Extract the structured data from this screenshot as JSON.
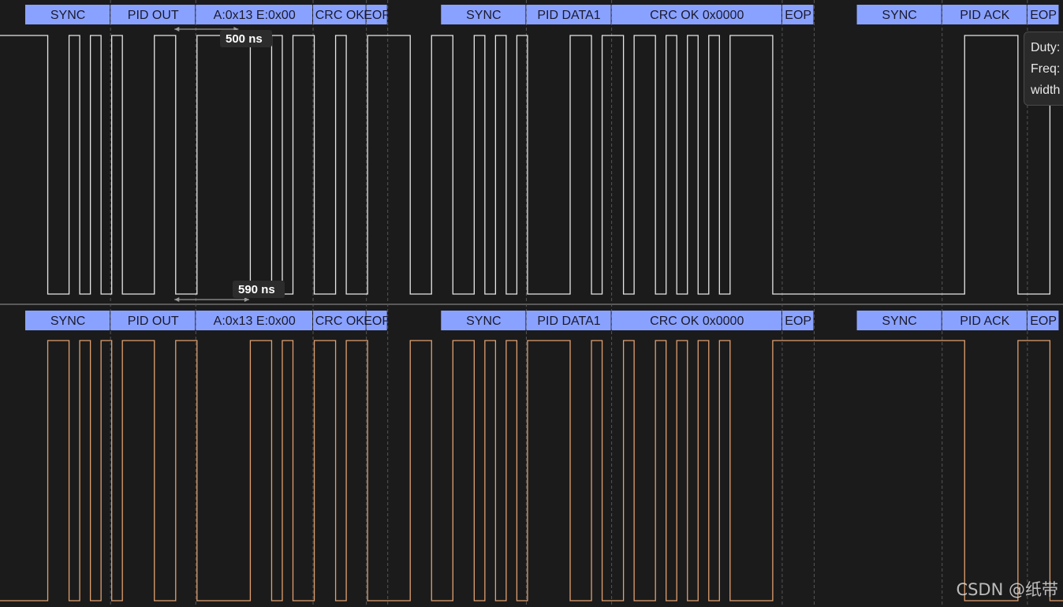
{
  "channels": [
    {
      "name": "channel-1",
      "color": "#e6e6e6",
      "bits": "11001010100011001111100101100100111100110010101000011011011010101011110000000000000000001111100011100101000001111",
      "decode": [
        {
          "label": "SYNC",
          "from": 0,
          "to": 8
        },
        {
          "label": "PID OUT",
          "from": 8,
          "to": 16
        },
        {
          "label": "A:0x13 E:0x00",
          "from": 16,
          "to": 27
        },
        {
          "label": "CRC OK",
          "from": 27,
          "to": 32
        },
        {
          "label": "EOP",
          "from": 32,
          "to": 34
        },
        {
          "label": "SYNC",
          "from": 39,
          "to": 47
        },
        {
          "label": "PID DATA1",
          "from": 47,
          "to": 55
        },
        {
          "label": "CRC OK 0x0000",
          "from": 55,
          "to": 71
        },
        {
          "label": "EOP",
          "from": 71,
          "to": 74
        },
        {
          "label": "SYNC",
          "from": 78,
          "to": 86
        },
        {
          "label": "PID ACK",
          "from": 86,
          "to": 94
        },
        {
          "label": "EOP",
          "from": 94,
          "to": 97
        }
      ]
    },
    {
      "name": "channel-2",
      "color": "#e0a070",
      "bits": "00110101011100110000011010011011000011001101010111100100100101010100001111111111111111110000011100011010111110000",
      "decode": [
        {
          "label": "SYNC",
          "from": 0,
          "to": 8
        },
        {
          "label": "PID OUT",
          "from": 8,
          "to": 16
        },
        {
          "label": "A:0x13 E:0x00",
          "from": 16,
          "to": 27
        },
        {
          "label": "CRC OK",
          "from": 27,
          "to": 32
        },
        {
          "label": "EOP",
          "from": 32,
          "to": 34
        },
        {
          "label": "SYNC",
          "from": 39,
          "to": 47
        },
        {
          "label": "PID DATA1",
          "from": 47,
          "to": 55
        },
        {
          "label": "CRC OK 0x0000",
          "from": 55,
          "to": 71
        },
        {
          "label": "EOP",
          "from": 71,
          "to": 74
        },
        {
          "label": "SYNC",
          "from": 78,
          "to": 86
        },
        {
          "label": "PID ACK",
          "from": 86,
          "to": 94
        },
        {
          "label": "EOP",
          "from": 94,
          "to": 97
        }
      ]
    }
  ],
  "measurements": [
    {
      "name": "width-measure-top",
      "label": "500 ns",
      "from_bit": 14,
      "to_bit": 20
    },
    {
      "name": "width-measure-bottom",
      "label": "590 ns",
      "from_bit": 14,
      "to_bit": 21
    }
  ],
  "tooltip": {
    "duty_label": "Duty:",
    "freq_label": "Freq:",
    "width_label": "width"
  },
  "colors": {
    "background": "#1b1b1b",
    "decode_fill": "#8aa2ff",
    "separator": "#5a5a5a",
    "marker": "#555555"
  },
  "watermark": "CSDN @纸带"
}
